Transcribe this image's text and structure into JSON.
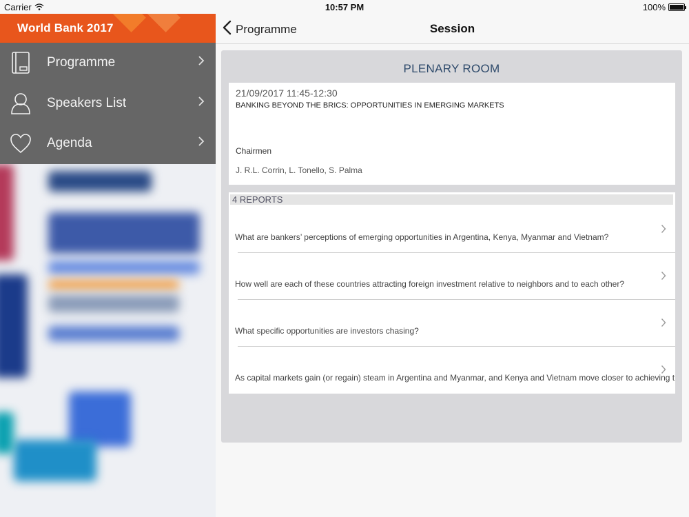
{
  "status_bar": {
    "carrier": "Carrier",
    "time": "10:57 PM",
    "battery": "100%"
  },
  "drawer": {
    "title": "World Bank 2017",
    "items": [
      {
        "label": "Programme",
        "icon": "book-icon"
      },
      {
        "label": "Speakers List",
        "icon": "person-icon"
      },
      {
        "label": "Agenda",
        "icon": "heart-icon"
      }
    ]
  },
  "navbar": {
    "back_label": "Programme",
    "title": "Session"
  },
  "session": {
    "room": "PLENARY ROOM",
    "datetime": "21/09/2017 11:45-12:30",
    "title": "BANKING BEYOND THE BRICS: OPPORTUNITIES IN EMERGING MARKETS",
    "role": "Chairmen",
    "chairmen": "J. R.L. Corrin, L. Tonello, S. Palma"
  },
  "reports": {
    "header": "4 REPORTS",
    "items": [
      "What are bankers’ perceptions of emerging opportunities in Argentina, Kenya, Myanmar and Vietnam?",
      "How well are each of these countries attracting foreign investment relative to neighbors and to each other?",
      "What specific opportunities are investors chasing?",
      "As capital markets gain (or regain) steam in Argentina and Myanmar, and Kenya and Vietnam move closer to achieving thei"
    ]
  },
  "colors": {
    "accent": "#e8561c",
    "menu_bg": "#666666",
    "room_title": "#2e4a6b"
  }
}
